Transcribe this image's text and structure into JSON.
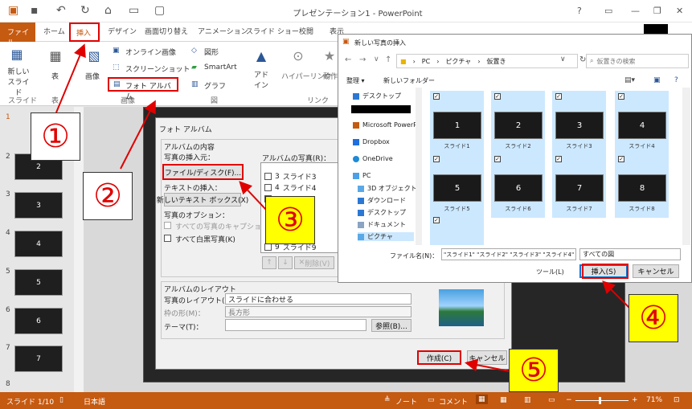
{
  "window": {
    "title": "プレゼンテーション1 - PowerPoint",
    "controls": [
      "?",
      "▭",
      "—",
      "❐",
      "✕"
    ]
  },
  "ribbon_tabs": [
    "ファイル",
    "ホーム",
    "挿入",
    "デザイン",
    "画面切り替え",
    "アニメーション",
    "スライド ショー",
    "校閲",
    "表示"
  ],
  "ribbon": {
    "new_slide": "新しい\nスライド",
    "table": "表",
    "image": "画像",
    "online_image": "オンライン画像",
    "screenshot": "スクリーンショット",
    "photo_album": "フォト アルバム",
    "shapes": "図形",
    "smartart": "SmartArt",
    "graph": "グラフ",
    "addin": "アド\nイン",
    "hyperlink": "ハイパーリンク",
    "action": "動作",
    "groups": {
      "slide": "スライド",
      "table": "表",
      "image": "画像",
      "figure": "図",
      "link": "リンク"
    }
  },
  "slides": [
    {
      "n": "1",
      "label": ""
    },
    {
      "n": "2",
      "label": "2"
    },
    {
      "n": "3",
      "label": "3"
    },
    {
      "n": "4",
      "label": "4"
    },
    {
      "n": "5",
      "label": "5"
    },
    {
      "n": "6",
      "label": "6"
    },
    {
      "n": "7",
      "label": "7"
    },
    {
      "n": "8",
      "label": ""
    }
  ],
  "album": {
    "title": "フォト アルバム",
    "content_legend": "アルバムの内容",
    "insert_from": "写真の挿入元：",
    "file_disk": "ファイル/ディスク(F)...",
    "text_insert": "テキストの挿入：",
    "new_text_box": "新しいテキスト ボックス(X)",
    "photo_options": "写真のオプション：",
    "caption_all": "すべての写真のキャプション(A)",
    "all_bw": "すべて白黒写真(K)",
    "album_photos": "アルバムの写真(R)：",
    "photo_list": [
      {
        "n": "3",
        "name": "スライド3"
      },
      {
        "n": "4",
        "name": "スライド4"
      },
      {
        "n": "",
        "name": "スライド5"
      },
      {
        "n": "9",
        "name": "スライド9"
      }
    ],
    "layout_legend": "アルバムのレイアウト",
    "layout_label": "写真のレイアウト(P)：",
    "layout_value": "スライドに合わせる",
    "frame_label": "枠の形(M)：",
    "frame_value": "長方形",
    "theme_label": "テーマ(T)：",
    "browse": "参照(B)...",
    "remove": "削除(V)",
    "create": "作成(C)",
    "cancel": "キャンセル"
  },
  "insert_dialog": {
    "title": "新しい写真の挿入",
    "breadcrumb": [
      "PC",
      "ピクチャ",
      "仮置き"
    ],
    "search_placeholder": "仮置きの検索",
    "organize": "整理 ▾",
    "new_folder": "新しいフォルダー",
    "nav": [
      "デスクトップ",
      "",
      "Microsoft PowerP",
      "Dropbox",
      "OneDrive",
      "PC",
      "3D オブジェクト",
      "ダウンロード",
      "デスクトップ",
      "ドキュメント",
      "ピクチャ"
    ],
    "files": [
      {
        "thumb": "1",
        "name": "スライド1"
      },
      {
        "thumb": "2",
        "name": "スライド2"
      },
      {
        "thumb": "3",
        "name": "スライド3"
      },
      {
        "thumb": "4",
        "name": "スライド4"
      },
      {
        "thumb": "5",
        "name": "スライド5"
      },
      {
        "thumb": "6",
        "name": "スライド6"
      },
      {
        "thumb": "7",
        "name": "スライド7"
      },
      {
        "thumb": "8",
        "name": "スライド8"
      },
      {
        "thumb": "",
        "name": ""
      }
    ],
    "filename_label": "ファイル名(N)：",
    "filename_value": "\"スライド1\" \"スライド2\" \"スライド3\" \"スライド4\" \"\"",
    "filter": "すべての図",
    "tools": "ツール(L)",
    "insert": "挿入(S)",
    "cancel": "キャンセル"
  },
  "callouts": [
    "①",
    "②",
    "③",
    "④",
    "⑤"
  ],
  "status": {
    "slide": "スライド 1/10",
    "lang": "日本語",
    "notes": "ノート",
    "comments": "コメント",
    "zoom": "71%"
  },
  "colors": {
    "accent": "#c55a11",
    "callout_red": "#e00000",
    "callout_yellow": "#ffff00",
    "selection": "#cce8ff"
  }
}
